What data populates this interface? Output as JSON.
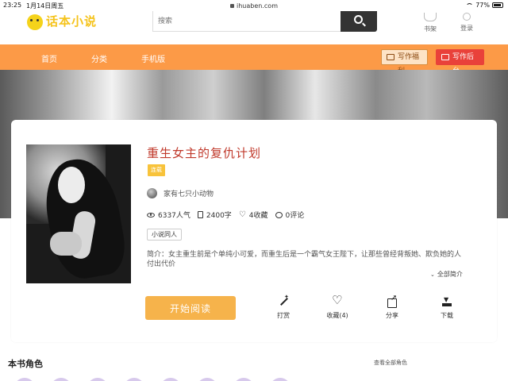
{
  "status_bar": {
    "time": "23:25",
    "date": "1月14日周五",
    "url": "ihuaben.com",
    "battery": "77%"
  },
  "header": {
    "logo_text": "话本小说",
    "search_placeholder": "搜索",
    "shelf_label": "书架",
    "login_label": "登录"
  },
  "nav": {
    "items": [
      "首页",
      "分类",
      "手机版"
    ],
    "welfare_label": "写作福利",
    "backend_label": "写作后台",
    "bg_color": "#fc9a47"
  },
  "book": {
    "title": "重生女主的复仇计划",
    "status": "连载",
    "author": "家有七只小动物",
    "popularity": "6337人气",
    "words": "2400字",
    "favorites": "4收藏",
    "comments": "0评论",
    "tag": "小说同人",
    "intro": "简介：女主重生前是个单纯小可爱，而重生后是一个霸气女王陛下，让那些曾经背叛她、欺负她的人付出代价",
    "more_label": "全部简介"
  },
  "actions": {
    "read_label": "开始阅读",
    "tip_label": "打赏",
    "fav_label": "收藏(4)",
    "share_label": "分享",
    "download_label": "下载"
  },
  "roles": {
    "title": "本书角色",
    "view_all": "查看全部角色"
  }
}
